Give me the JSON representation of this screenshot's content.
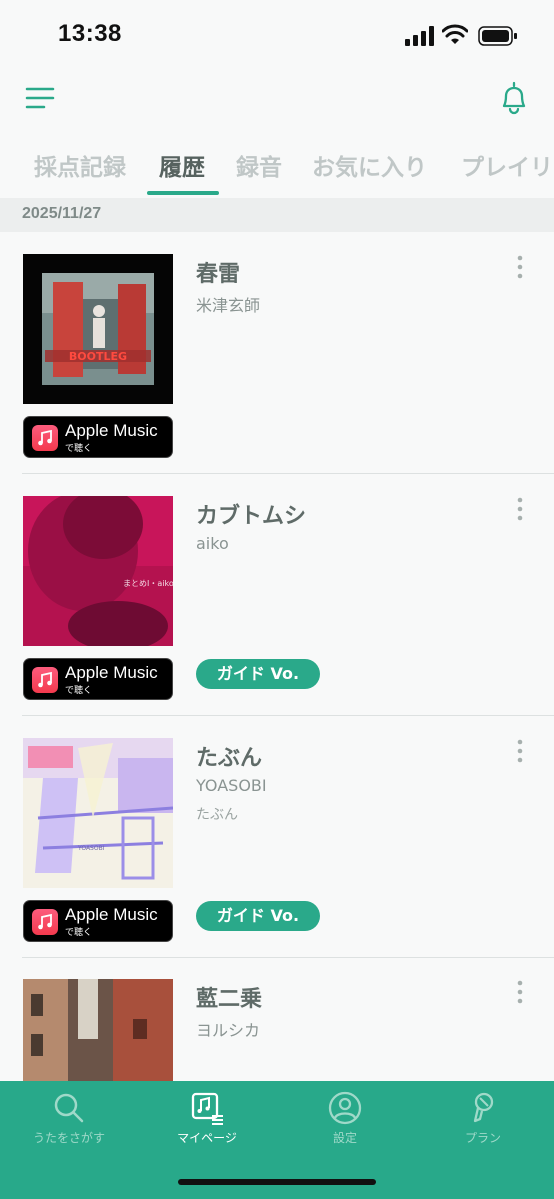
{
  "status_bar": {
    "time": "13:38"
  },
  "tabs": [
    {
      "label": "採点記録",
      "active": false
    },
    {
      "label": "履歴",
      "active": true
    },
    {
      "label": "録音",
      "active": false
    },
    {
      "label": "お気に入り",
      "active": false
    },
    {
      "label": "プレイリ",
      "active": false
    }
  ],
  "date_header": "2025/11/27",
  "apple_music": {
    "title": "Apple Music",
    "sub": "で聴く"
  },
  "songs": [
    {
      "title": "春雷",
      "artist": "米津玄師",
      "subtitle": "",
      "guide": "",
      "cover_text": "BOOTLEG"
    },
    {
      "title": "カブトムシ",
      "artist": "aiko",
      "subtitle": "",
      "guide": "ガイド Vo.",
      "cover_text": "まとめⅠ・aiko"
    },
    {
      "title": "たぶん",
      "artist": "YOASOBI",
      "subtitle": "たぶん",
      "guide": "ガイド Vo.",
      "cover_text": "YOASOBI"
    },
    {
      "title": "藍二乗",
      "artist": "ヨルシカ",
      "subtitle": "",
      "guide": "",
      "cover_text": ""
    }
  ],
  "bottom_nav": [
    {
      "label": "うたをさがす",
      "icon": "search-icon",
      "active": false
    },
    {
      "label": "マイページ",
      "icon": "mypage-icon",
      "active": true
    },
    {
      "label": "設定",
      "icon": "user-icon",
      "active": false
    },
    {
      "label": "プラン",
      "icon": "plan-icon",
      "active": false
    }
  ],
  "colors": {
    "accent": "#2aa98a",
    "nav_bg": "#28a98a",
    "text": "#5f6b68"
  }
}
